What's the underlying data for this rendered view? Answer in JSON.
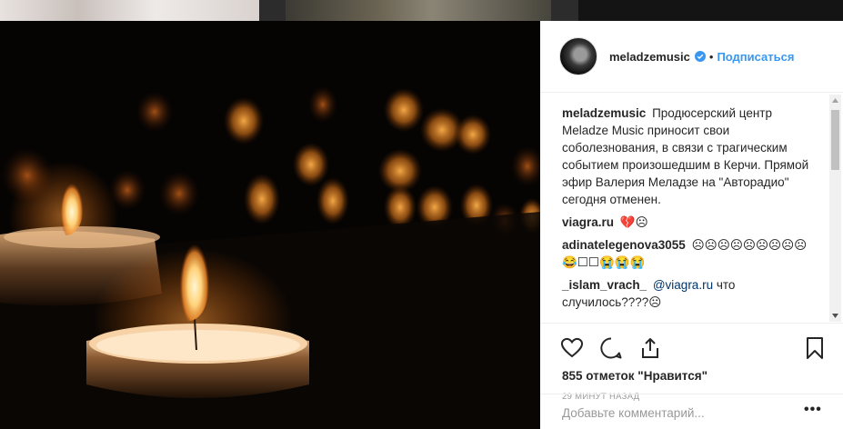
{
  "post": {
    "username": "meladzemusic",
    "follow_label": "Подписаться",
    "separator": "•",
    "caption": {
      "user": "meladzemusic",
      "text": "Продюсерский центр Meladze Music приносит свои соболезнования, в связи с трагическим событием произошедшим в Керчи. Прямой эфир Валерия Меладзе на \"Авторадио\" сегодня отменен."
    },
    "comments": [
      {
        "user": "viagra.ru",
        "text": "💔☹"
      },
      {
        "user": "adinatelegenova3055",
        "text": "☹☹☹☹☹☹☹☹☹😂☐☐😭😭😭"
      },
      {
        "user": "_islam_vrach_",
        "mention": "@viagra.ru",
        "text": "что случилось????☹"
      }
    ],
    "likes": "855 отметок \"Нравится\"",
    "time_ago": "29 минут назад",
    "comment_placeholder": "Добавьте комментарий...",
    "more_label": "•••"
  },
  "icons": [
    "heart-icon",
    "comment-icon",
    "share-icon",
    "bookmark-icon",
    "verified-icon"
  ],
  "colors": {
    "accent": "#3897f0",
    "verified": "#3897f0",
    "muted": "#999999",
    "text": "#262626"
  }
}
